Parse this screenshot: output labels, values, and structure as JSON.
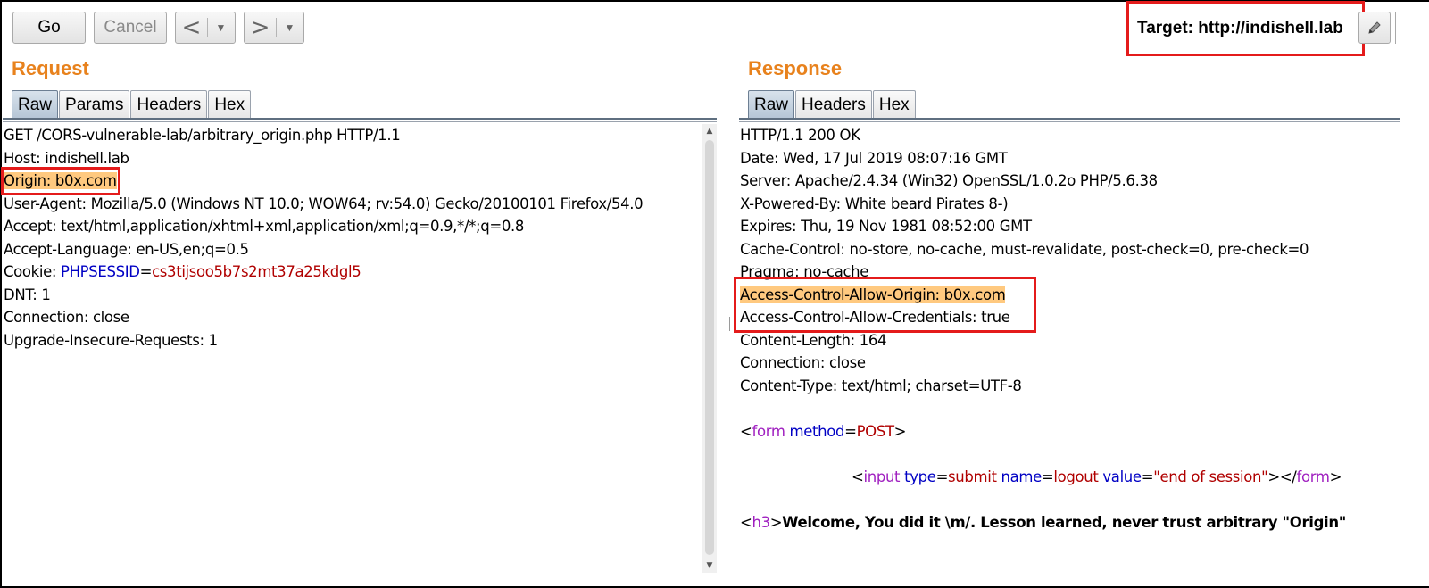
{
  "toolbar": {
    "go_label": "Go",
    "cancel_label": "Cancel",
    "back_arrow": "<",
    "forward_arrow": ">",
    "dropdown_glyph": "▼"
  },
  "target": {
    "label": "Target: http://indishell.lab"
  },
  "request": {
    "title": "Request",
    "tabs": [
      "Raw",
      "Params",
      "Headers",
      "Hex"
    ],
    "active_tab": "Raw",
    "lines": {
      "request_line": "GET /CORS-vulnerable-lab/arbitrary_origin.php HTTP/1.1",
      "host": "Host: indishell.lab",
      "origin": "Origin: b0x.com",
      "user_agent": "User-Agent: Mozilla/5.0 (Windows NT 10.0; WOW64; rv:54.0) Gecko/20100101 Firefox/54.0",
      "accept": "Accept: text/html,application/xhtml+xml,application/xml;q=0.9,*/*;q=0.8",
      "accept_language": "Accept-Language: en-US,en;q=0.5",
      "cookie_prefix": "Cookie: ",
      "cookie_name": "PHPSESSID",
      "cookie_eq": "=",
      "cookie_value": "cs3tijsoo5b7s2mt37a25kdgl5",
      "dnt": "DNT: 1",
      "connection": "Connection: close",
      "upgrade": "Upgrade-Insecure-Requests: 1"
    }
  },
  "response": {
    "title": "Response",
    "tabs": [
      "Raw",
      "Headers",
      "Hex"
    ],
    "active_tab": "Raw",
    "lines": {
      "status": "HTTP/1.1 200 OK",
      "date": "Date: Wed, 17 Jul 2019 08:07:16 GMT",
      "server": "Server: Apache/2.4.34 (Win32) OpenSSL/1.0.2o PHP/5.6.38",
      "powered_by": "X-Powered-By: White beard Pirates 8-)",
      "expires": "Expires: Thu, 19 Nov 1981 08:52:00 GMT",
      "cache_control": "Cache-Control: no-store, no-cache, must-revalidate, post-check=0, pre-check=0",
      "pragma": "Pragma: no-cache",
      "acao": "Access-Control-Allow-Origin: b0x.com",
      "acac": "Access-Control-Allow-Credentials: true",
      "content_length": "Content-Length: 164",
      "connection": "Connection: close",
      "content_type": "Content-Type: text/html; charset=UTF-8"
    },
    "body": {
      "form_open": {
        "lt": "<",
        "tag": "form",
        "attr": "method",
        "eq": "=",
        "val": "POST",
        "gt": ">"
      },
      "input": {
        "lt": "<",
        "tag": "input",
        "a1": "type",
        "v1": "submit",
        "a2": "name",
        "v2": "logout",
        "a3": "value",
        "v3": "\"end of session\"",
        "close": "></",
        "close_tag": "form",
        "gt": ">"
      },
      "h3": {
        "lt": "<",
        "tag": "h3",
        "gt": ">",
        "text": "Welcome, You did it \\m/. Lesson learned, never trust arbitrary \"Origin\""
      }
    }
  },
  "colors": {
    "section_title": "#e8821d",
    "highlight": "#ffc97f",
    "annotation_box": "#e41b1b",
    "tag": "#a020c0",
    "attr": "#0000c4",
    "value": "#b00000"
  }
}
